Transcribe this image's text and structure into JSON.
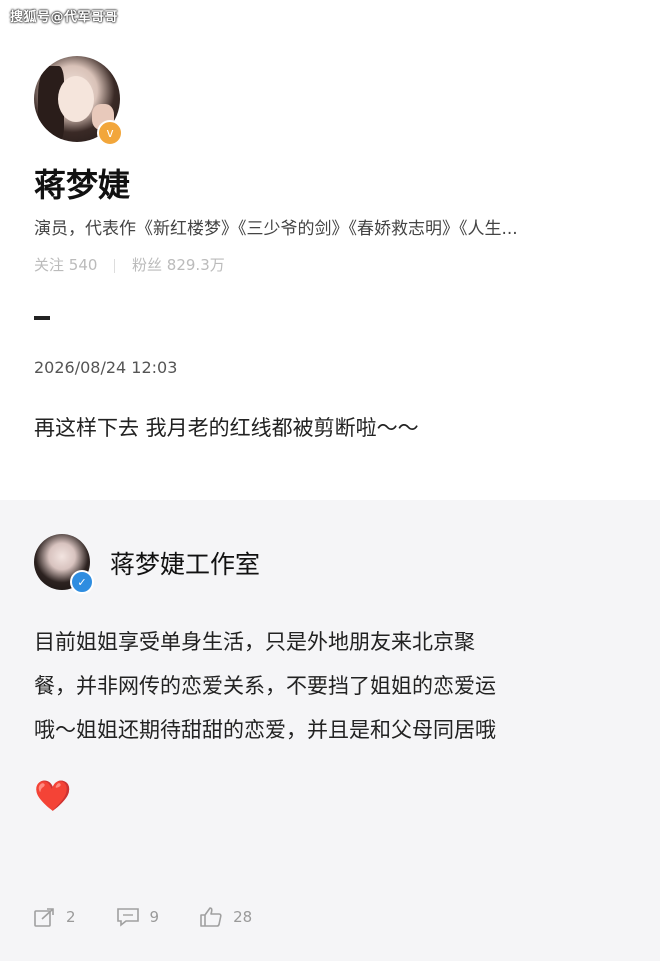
{
  "source_watermark": "搜狐号@代军哥哥",
  "profile": {
    "name": "蒋梦婕",
    "bio": "演员，代表作《新红楼梦》《三少爷的剑》《春娇救志明》《人生...",
    "following_label": "关注",
    "following_count": "540",
    "followers_label": "粉丝",
    "followers_count": "829.3万",
    "badge_icon": "gold-v-badge"
  },
  "post": {
    "timestamp": "2026/08/24 12:03",
    "text": "再这样下去 我月老的红线都被剪断啦～～"
  },
  "studio_reply": {
    "name": "蒋梦婕工作室",
    "badge_icon": "blue-verified-badge",
    "lines": [
      "目前姐姐享受单身生活，只是外地朋友来北京聚",
      "餐，并非网传的恋爱关系，不要挡了姐姐的恋爱运",
      "哦～姐姐还期待甜甜的恋爱，并且是和父母同居哦"
    ],
    "emoji": "❤️"
  },
  "actions": {
    "share_count": "2",
    "comment_count": "9",
    "like_count": "28"
  },
  "colors": {
    "background": "#ffffff",
    "reply_background": "#f5f5f7",
    "gold_badge": "#f2a63b",
    "blue_badge": "#2f8de0",
    "heart": "#e8403a"
  }
}
